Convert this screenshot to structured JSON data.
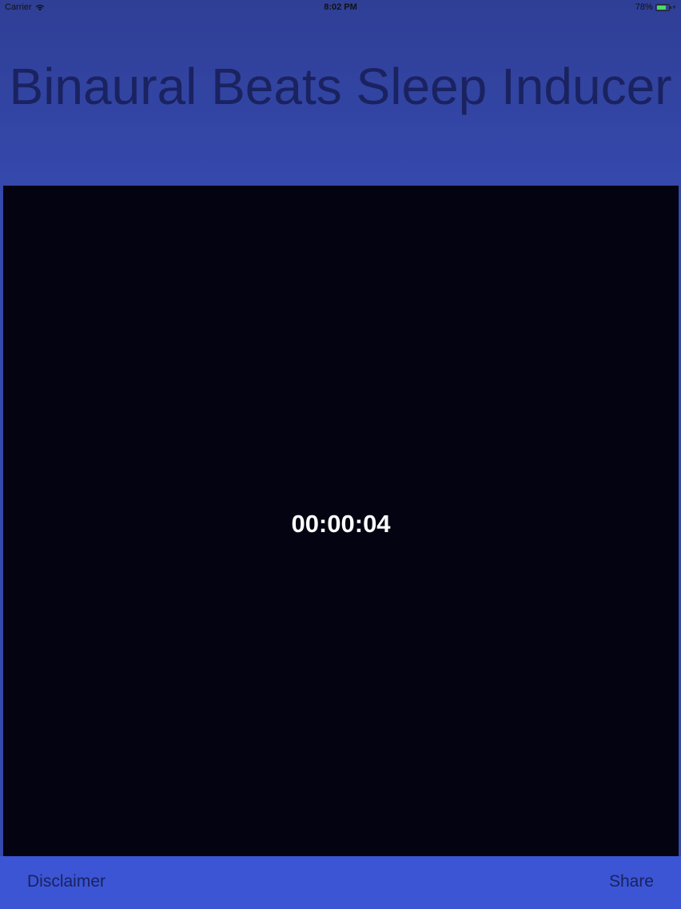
{
  "status_bar": {
    "carrier": "Carrier",
    "time": "8:02 PM",
    "battery": "78%",
    "battery_level": 0.78,
    "battery_color": "#4cd964"
  },
  "header": {
    "title": "Binaural Beats Sleep Inducer"
  },
  "main": {
    "timer": "00:00:04"
  },
  "toolbar": {
    "disclaimer_label": "Disclaimer",
    "share_label": "Share"
  },
  "colors": {
    "background": "#3548ac",
    "panel": "#030312",
    "toolbar": "#3b55d4",
    "title_text": "#1a2260",
    "timer_text": "#ffffff"
  }
}
